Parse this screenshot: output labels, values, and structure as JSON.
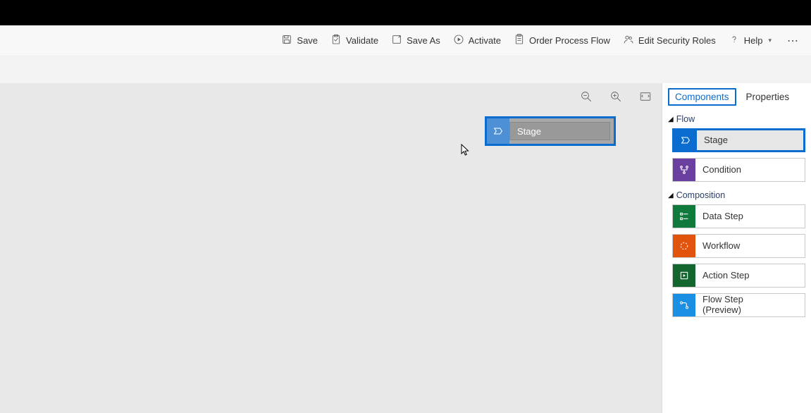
{
  "commandBar": {
    "save": "Save",
    "validate": "Validate",
    "saveAs": "Save As",
    "activate": "Activate",
    "processName": "Order Process Flow",
    "editSecurityRoles": "Edit Security Roles",
    "help": "Help"
  },
  "canvas": {
    "dragTile": {
      "label": "Stage"
    }
  },
  "panel": {
    "tabs": {
      "components": "Components",
      "properties": "Properties",
      "active": "components"
    },
    "sections": {
      "flow": {
        "title": "Flow",
        "items": [
          {
            "key": "stage",
            "label": "Stage",
            "color": "blue",
            "highlighted": true
          },
          {
            "key": "condition",
            "label": "Condition",
            "color": "purple",
            "highlighted": false
          }
        ]
      },
      "composition": {
        "title": "Composition",
        "items": [
          {
            "key": "dataStep",
            "label": "Data Step",
            "color": "green",
            "highlighted": false
          },
          {
            "key": "workflow",
            "label": "Workflow",
            "color": "orange",
            "highlighted": false
          },
          {
            "key": "actionStep",
            "label": "Action Step",
            "color": "dgreen",
            "highlighted": false
          },
          {
            "key": "flowStep",
            "label": "Flow Step\n(Preview)",
            "color": "lblue",
            "highlighted": false
          }
        ]
      }
    }
  }
}
